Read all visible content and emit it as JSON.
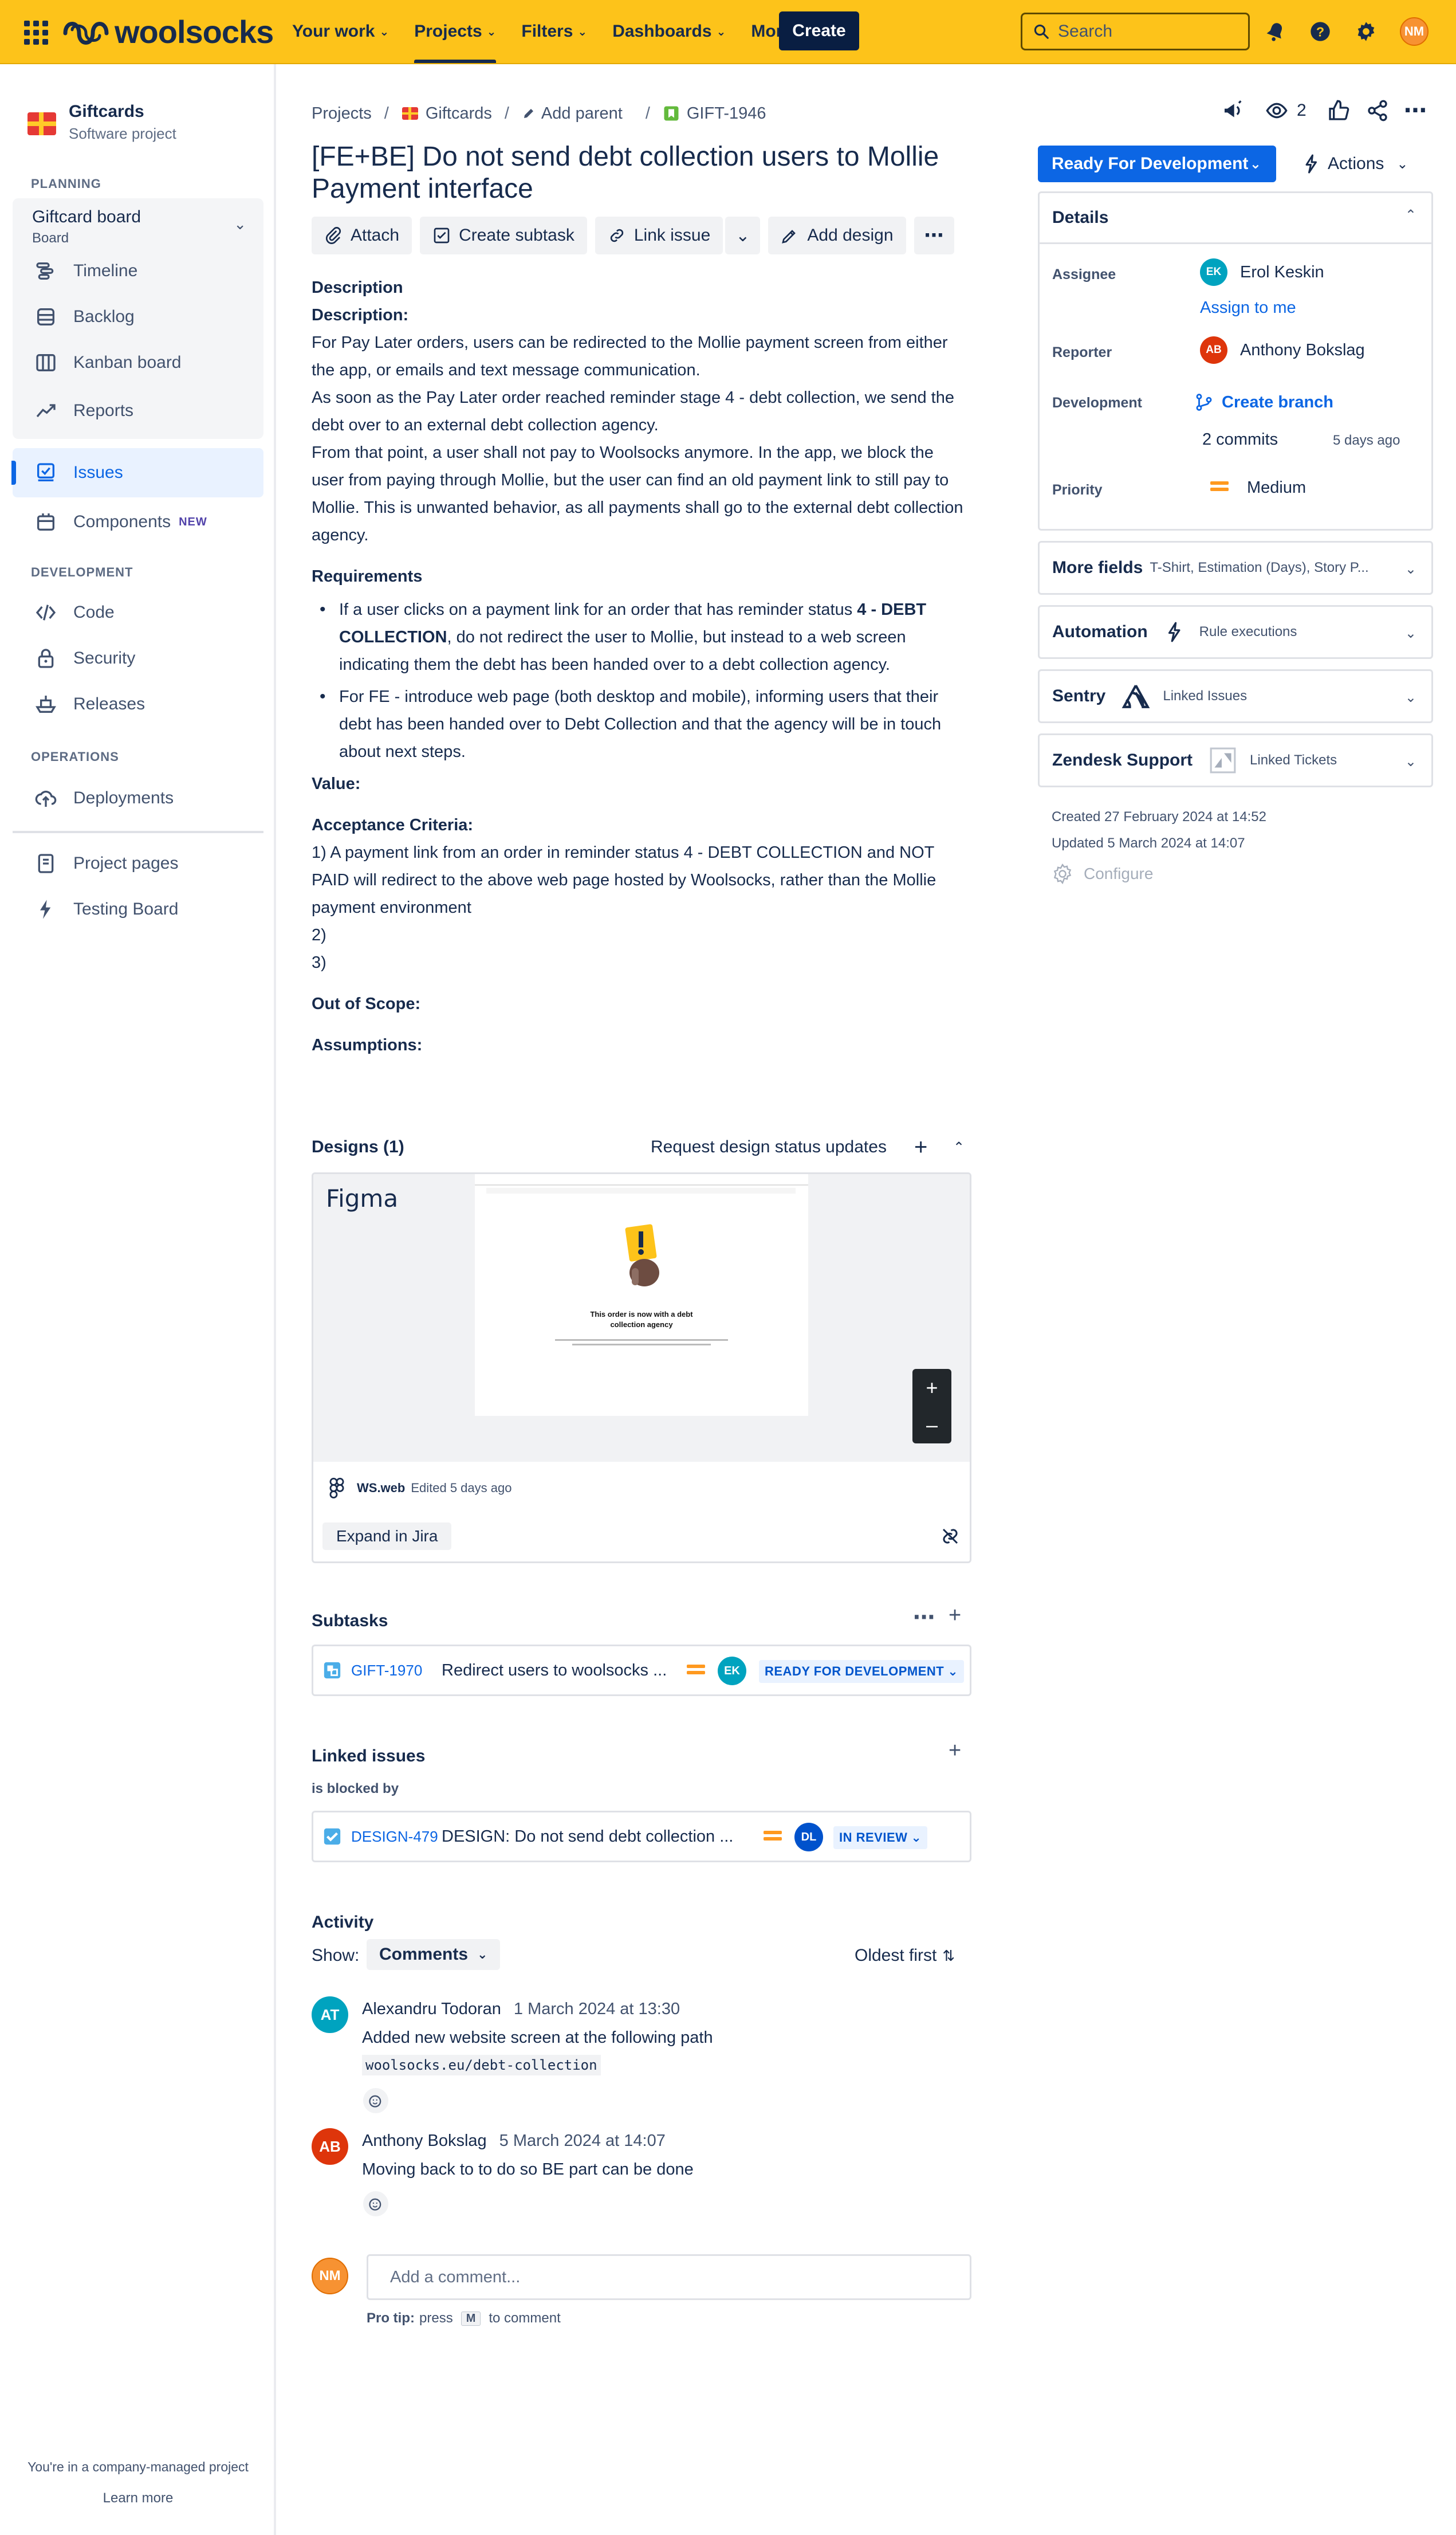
{
  "topbar": {
    "brand": "woolsocks",
    "nav": [
      {
        "label": "Your work",
        "active": false
      },
      {
        "label": "Projects",
        "active": true
      },
      {
        "label": "Filters",
        "active": false
      },
      {
        "label": "Dashboards",
        "active": false
      },
      {
        "label": "More",
        "active": false
      }
    ],
    "create_label": "Create",
    "search_placeholder": "Search",
    "user_initials": "NM",
    "colors": {
      "bar": "#fdc31a",
      "create": "#091e42"
    }
  },
  "sidebar": {
    "project_name": "Giftcards",
    "project_type": "Software project",
    "planning_heading": "PLANNING",
    "board_title": "Giftcard board",
    "board_sub": "Board",
    "board_items": [
      "Timeline",
      "Backlog",
      "Kanban board",
      "Reports"
    ],
    "issues_label": "Issues",
    "components_label": "Components",
    "components_badge": "NEW",
    "development_heading": "DEVELOPMENT",
    "dev_items": [
      "Code",
      "Security",
      "Releases"
    ],
    "operations_heading": "OPERATIONS",
    "ops_items": [
      "Deployments"
    ],
    "extra_items": [
      "Project pages",
      "Testing Board"
    ],
    "footer_text": "You're in a company-managed project",
    "footer_link": "Learn more"
  },
  "breadcrumb": {
    "projects": "Projects",
    "project": "Giftcards",
    "add_parent": "Add parent",
    "issue_key": "GIFT-1946"
  },
  "issue": {
    "title": "[FE+BE] Do not send debt collection users to Mollie Payment interface",
    "toolbar": {
      "attach": "Attach",
      "create_subtask": "Create subtask",
      "link_issue": "Link issue",
      "add_design": "Add design"
    },
    "description": {
      "heading": "Description",
      "sub_heading": "Description:",
      "paragraphs": [
        "For Pay Later orders, users can be redirected to the Mollie payment screen from either the app, or emails and text message communication.",
        "As soon as the Pay Later order reached reminder stage 4 - debt collection, we send the debt over to an external debt collection agency.",
        "From that point, a user shall not pay to Woolsocks anymore. In the app, we block the user from paying through Mollie, but the user can find an old payment link to still pay to Mollie. This is unwanted behavior, as all payments shall go to the external debt collection agency."
      ],
      "requirements_heading": "Requirements",
      "req1_a": "If a user clicks on a payment link for an order that has reminder status ",
      "req1_b": "4 - DEBT COLLECTION",
      "req1_c": ", do not redirect the user to Mollie, but instead to a web screen indicating them the debt has been handed over to a debt collection agency.",
      "req2": "For FE - introduce web page (both desktop and mobile), informing users that their debt has been handed over to Debt Collection and that the agency will be in touch about next steps.",
      "value_heading": "Value:",
      "acceptance_heading": "Acceptance Criteria:",
      "acceptance_lines": [
        "1) A payment link from an order in reminder status 4 - DEBT COLLECTION and NOT PAID will redirect to the above web page hosted by Woolsocks, rather than the Mollie payment environment",
        "2)",
        "3)"
      ],
      "out_of_scope": "Out of Scope:",
      "assumptions": "Assumptions:"
    },
    "designs": {
      "heading": "Designs (1)",
      "request_label": "Request design status updates",
      "provider": "Figma",
      "mock_title": "This order is now with a debt collection agency",
      "file_name": "WS.web",
      "edited": "Edited 5 days ago",
      "expand_label": "Expand in Jira"
    },
    "subtasks": {
      "heading": "Subtasks",
      "items": [
        {
          "key": "GIFT-1970",
          "summary": "Redirect users to woolsocks ...",
          "assignee": "EK",
          "status": "READY FOR DEVELOPMENT"
        }
      ]
    },
    "linked": {
      "heading": "Linked issues",
      "relation": "is blocked by",
      "items": [
        {
          "key": "DESIGN-479",
          "summary": "DESIGN: Do not send debt collection ...",
          "assignee": "DL",
          "status": "IN REVIEW"
        }
      ]
    },
    "activity": {
      "heading": "Activity",
      "show_label": "Show:",
      "filter": "Comments",
      "sort": "Oldest first",
      "comments": [
        {
          "initials": "AT",
          "author": "Alexandru Todoran",
          "time": "1 March 2024 at 13:30",
          "body": "Added new website screen at the following path",
          "code": "woolsocks.eu/debt-collection"
        },
        {
          "initials": "AB",
          "author": "Anthony Bokslag",
          "time": "5 March 2024 at 14:07",
          "body": "Moving back to to do so BE part can be done"
        }
      ],
      "new_comment_initials": "NM",
      "new_comment_placeholder": "Add a comment...",
      "protip_label": "Pro tip:",
      "protip_press": "press",
      "protip_key": "M",
      "protip_rest": "to comment"
    }
  },
  "right": {
    "watch_count": "2",
    "status": "Ready For Development",
    "actions_label": "Actions",
    "details": {
      "heading": "Details",
      "assignee_label": "Assignee",
      "assignee_initials": "EK",
      "assignee": "Erol Keskin",
      "assign_to_me": "Assign to me",
      "reporter_label": "Reporter",
      "reporter_initials": "AB",
      "reporter": "Anthony Bokslag",
      "development_label": "Development",
      "create_branch": "Create branch",
      "commits": "2 commits",
      "commits_time": "5 days ago",
      "priority_label": "Priority",
      "priority": "Medium"
    },
    "more_fields": {
      "heading": "More fields",
      "sub": "T-Shirt, Estimation (Days), Story P..."
    },
    "automation": {
      "heading": "Automation",
      "sub": "Rule executions"
    },
    "sentry": {
      "heading": "Sentry",
      "sub": "Linked Issues"
    },
    "zendesk": {
      "heading": "Zendesk Support",
      "sub": "Linked Tickets"
    },
    "created": "Created 27 February 2024 at 14:52",
    "updated": "Updated 5 March 2024 at 14:07",
    "configure": "Configure"
  }
}
